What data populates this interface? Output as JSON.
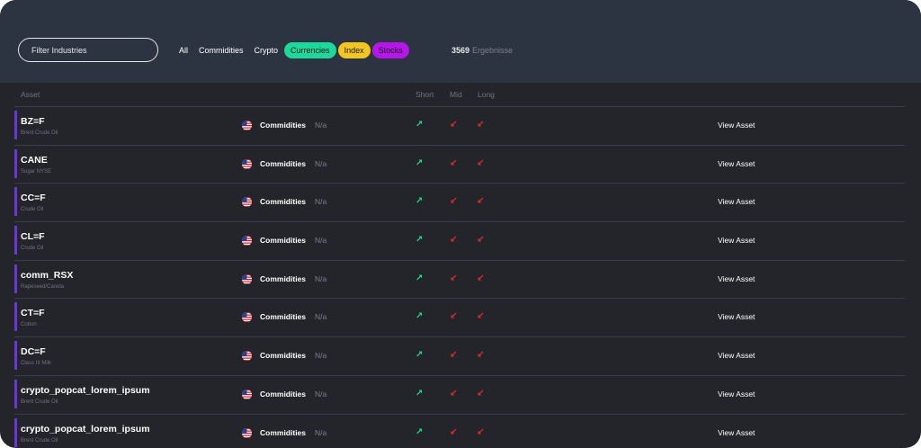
{
  "filter": {
    "placeholder": "Filter Industries"
  },
  "tabs": [
    {
      "label": "All"
    },
    {
      "label": "Commidities"
    },
    {
      "label": "Crypto"
    },
    {
      "label": "Currencies",
      "color": "#1ed79a"
    },
    {
      "label": "Index",
      "color": "#f2c522"
    },
    {
      "label": "Stocks",
      "color": "#b517e8"
    }
  ],
  "results": {
    "count": "3569",
    "label": "Ergebnisse"
  },
  "columns": {
    "asset": "Asset",
    "short": "Short",
    "mid": "Mid",
    "long": "Long"
  },
  "colors": {
    "accent": "#6a36d9",
    "up": "#1fe07a",
    "down": "#ee2a2a",
    "header_bg": "#2d3441",
    "body_bg": "#23252b"
  },
  "rows": [
    {
      "name": "BZ=F",
      "desc": "Brent Crude Oil",
      "category": "Commidities",
      "na": "N/a",
      "short": "up-right-arrow",
      "mid": "down-left-arrow",
      "long": "down-left-arrow",
      "action": "View Asset"
    },
    {
      "name": "CANE",
      "desc": "Sugar NYSE",
      "category": "Commidities",
      "na": "N/a",
      "short": "up-right-arrow",
      "mid": "down-left-arrow",
      "long": "down-left-arrow",
      "action": "View Asset"
    },
    {
      "name": "CC=F",
      "desc": "Crude Oil",
      "category": "Commidities",
      "na": "N/a",
      "short": "up-right-arrow",
      "mid": "down-left-arrow",
      "long": "down-left-arrow",
      "action": "View Asset"
    },
    {
      "name": "CL=F",
      "desc": "Crude Oil",
      "category": "Commidities",
      "na": "N/a",
      "short": "up-right-arrow",
      "mid": "down-left-arrow",
      "long": "down-left-arrow",
      "action": "View Asset"
    },
    {
      "name": "comm_RSX",
      "desc": "Rapeseed/Canola",
      "category": "Commidities",
      "na": "N/a",
      "short": "up-right-arrow",
      "mid": "down-left-arrow",
      "long": "down-left-arrow",
      "action": "View Asset"
    },
    {
      "name": "CT=F",
      "desc": "Cotton",
      "category": "Commidities",
      "na": "N/a",
      "short": "up-right-arrow",
      "mid": "down-left-arrow",
      "long": "down-left-arrow",
      "action": "View Asset"
    },
    {
      "name": "DC=F",
      "desc": "Class III Milk",
      "category": "Commidities",
      "na": "N/a",
      "short": "up-right-arrow",
      "mid": "down-left-arrow",
      "long": "down-left-arrow",
      "action": "View Asset"
    },
    {
      "name": "crypto_popcat_lorem_ipsum",
      "desc": "Brent Crude Oil",
      "category": "Commidities",
      "na": "N/a",
      "short": "up-right-arrow",
      "mid": "down-left-arrow",
      "long": "down-left-arrow",
      "action": "View Asset"
    },
    {
      "name": "crypto_popcat_lorem_ipsum",
      "desc": "Brent Crude Oil",
      "category": "Commidities",
      "na": "N/a",
      "short": "up-right-arrow",
      "mid": "down-left-arrow",
      "long": "down-left-arrow",
      "action": "View Asset"
    }
  ]
}
